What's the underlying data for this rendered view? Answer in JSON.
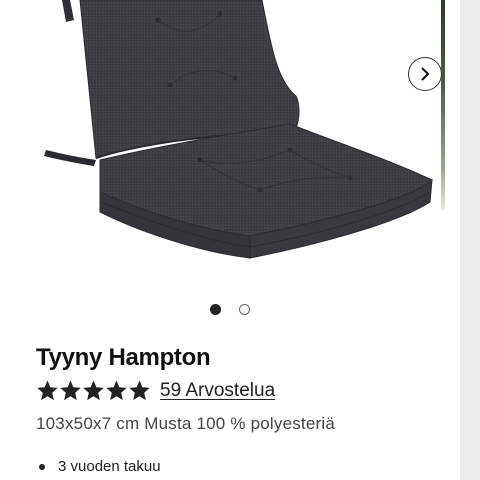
{
  "gallery": {
    "product_image": "seat-cushion-image",
    "next_icon": "chevron-right-icon",
    "dots": [
      {
        "state": "active"
      },
      {
        "state": "inactive"
      }
    ]
  },
  "product": {
    "title": "Tyyny Hampton",
    "rating": 5,
    "rating_max": 5,
    "reviews_label": "59 Arvostelua",
    "description": "103x50x7 cm Musta 100 % polyesteriä",
    "features": [
      "3 vuoden takuu"
    ]
  },
  "colors": {
    "cushion": "#3d3e42",
    "text": "#111111",
    "accent": "#222222"
  }
}
